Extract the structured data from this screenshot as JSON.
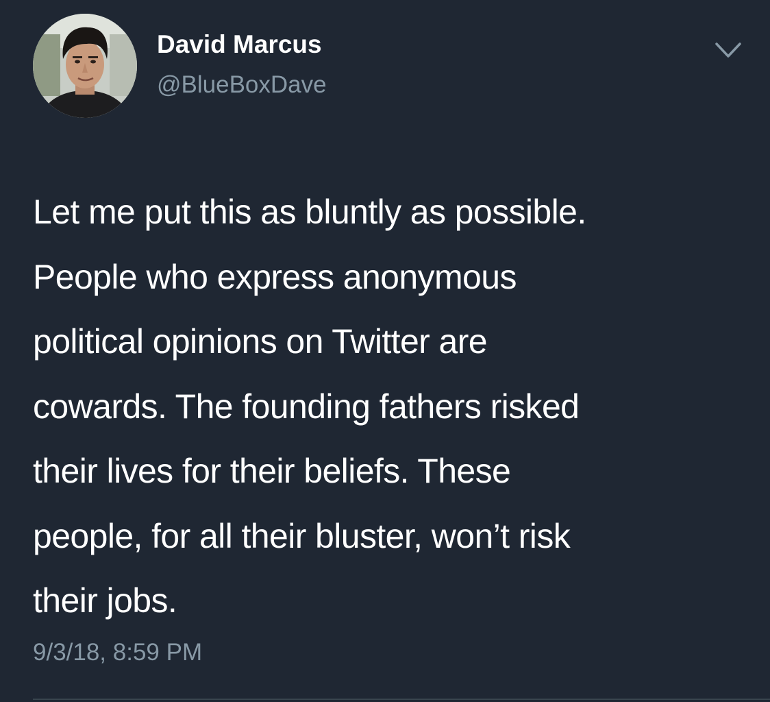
{
  "tweet": {
    "author": {
      "display_name": "David Marcus",
      "handle": "@BlueBoxDave",
      "avatar_icon": "profile-photo"
    },
    "menu_icon": "chevron-down-icon",
    "text": "Let me put this as bluntly as possible.\nPeople who express anonymous\npolitical opinions on Twitter are\ncowards. The founding fathers risked\ntheir lives for their beliefs. These\npeople, for all their bluster, won’t risk\ntheir jobs.",
    "timestamp": "9/3/18, 8:59 PM"
  },
  "colors": {
    "background": "#1f2733",
    "primary_text": "#ffffff",
    "secondary_text": "#8899a6",
    "divider": "#38444d"
  }
}
